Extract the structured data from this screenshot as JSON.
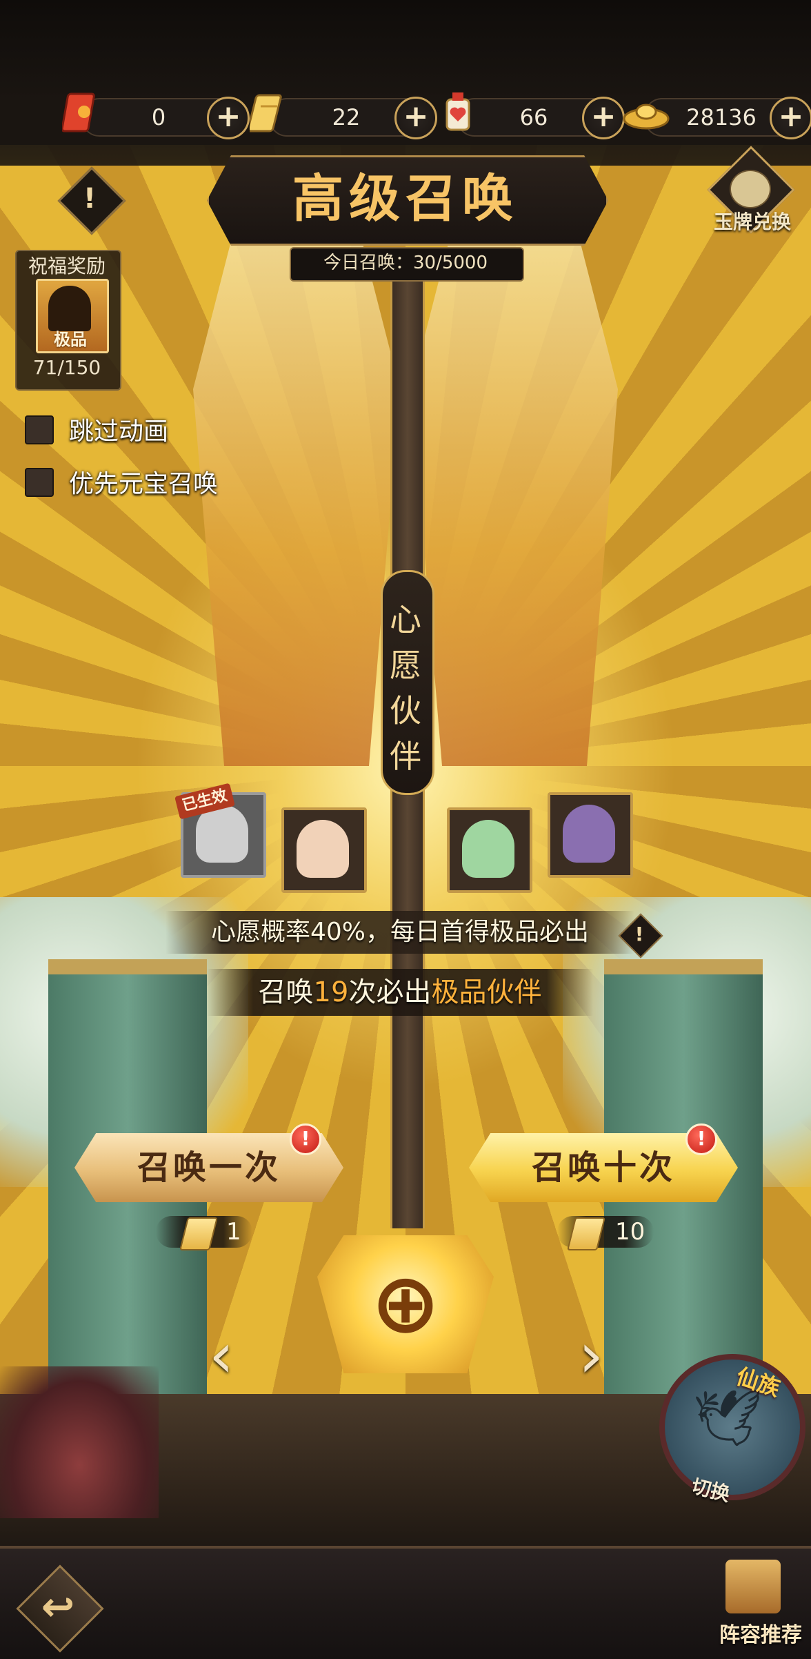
{
  "resources": [
    {
      "name": "red-ticket",
      "value": "0"
    },
    {
      "name": "gold-ticket",
      "value": "22"
    },
    {
      "name": "heart-charm",
      "value": "66"
    },
    {
      "name": "gold-ingot",
      "value": "28136"
    }
  ],
  "header": {
    "title": "高级召唤",
    "daily_summon": "今日召唤：30/5000",
    "jade_exchange_label": "玉牌兑换"
  },
  "blessing": {
    "label": "祝福奖励",
    "grade": "极品",
    "progress": "71/150"
  },
  "options": {
    "skip_animation": "跳过动画",
    "prefer_ingot": "优先元宝召唤"
  },
  "wish": {
    "title_chars": [
      "心",
      "愿",
      "伙",
      "伴"
    ],
    "effect_badge": "已生效"
  },
  "rates": {
    "wish_rate_text": "心愿概率40%，每日首得极品必出",
    "pity_prefix": "召唤",
    "pity_count": "19",
    "pity_middle": "次必出",
    "pity_suffix": "极品伙伴"
  },
  "summon": {
    "once_label": "召唤一次",
    "once_cost": "1",
    "ten_label": "召唤十次",
    "ten_cost": "10",
    "alert_glyph": "!"
  },
  "faction": {
    "name": "仙族",
    "switch_label": "切换"
  },
  "bottom": {
    "lineup_label": "阵容推荐"
  },
  "colors": {
    "accent_gold": "#f7c466",
    "pity_highlight": "#ffb23c",
    "alert_red": "#c21a12"
  }
}
